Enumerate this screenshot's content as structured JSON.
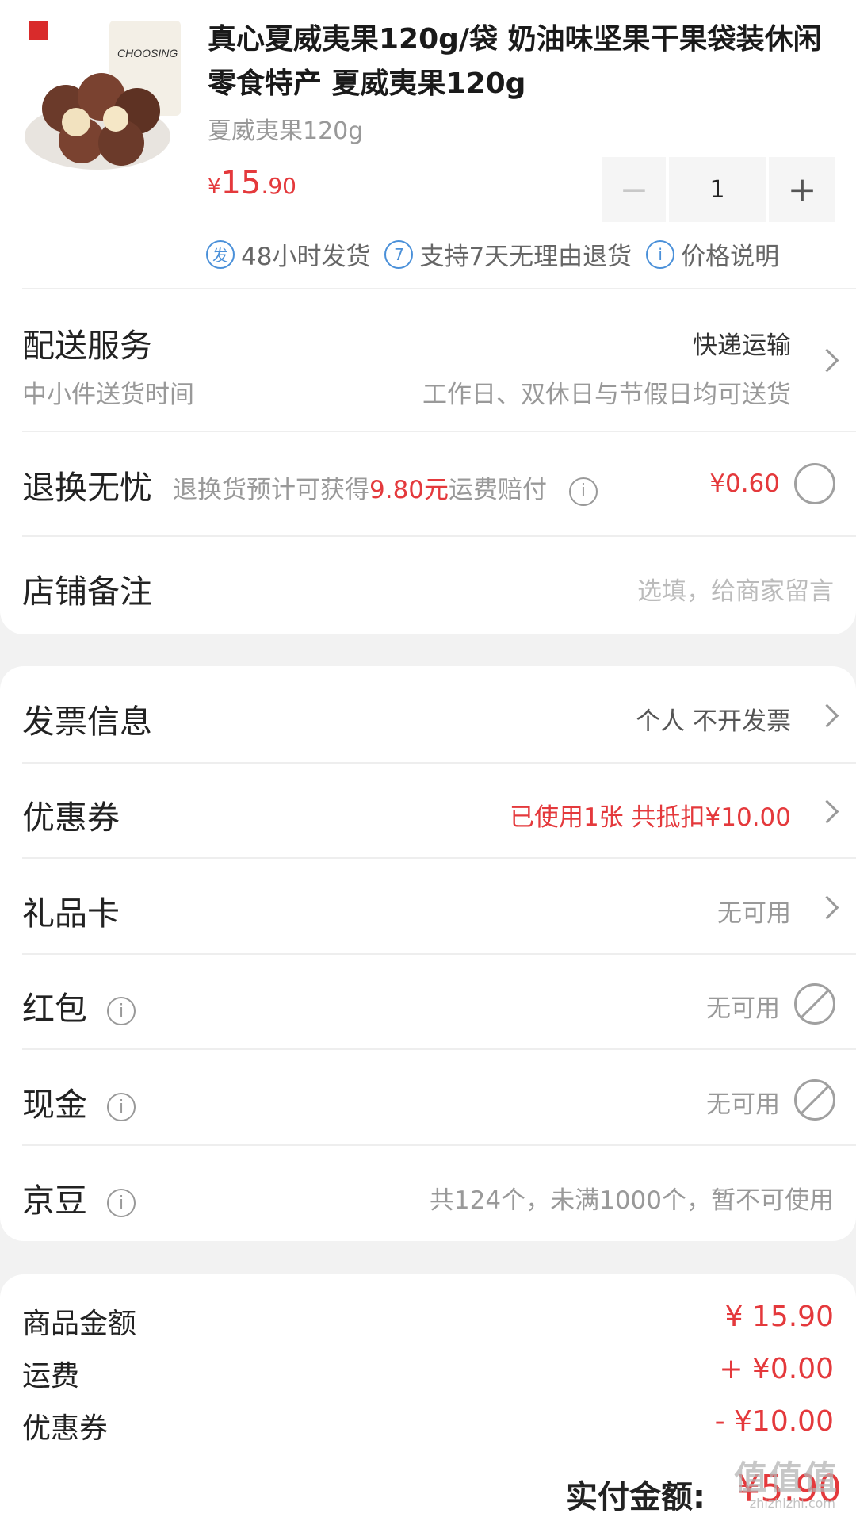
{
  "product": {
    "title": "真心夏威夷果120g/袋 奶油味坚果干果袋装休闲零食特产 夏威夷果120g",
    "spec": "夏威夷果120g",
    "price_currency": "¥",
    "price_int": "15",
    "price_dec": ".90",
    "quantity": "1",
    "badges": [
      {
        "icon_text": "发",
        "label": "48小时发货"
      },
      {
        "icon_text": "7",
        "label": "支持7天无理由退货"
      },
      {
        "icon_text": "i",
        "label": "价格说明"
      }
    ]
  },
  "delivery": {
    "title": "配送服务",
    "method": "快递运输",
    "sub_label": "中小件送货时间",
    "sub_value": "工作日、双休日与节假日均可送货"
  },
  "return_worry": {
    "title": "退换无忧",
    "desc_prefix": "退换货预计可获得",
    "desc_amount": "9.80元",
    "desc_suffix": "运费赔付",
    "price": "¥0.60"
  },
  "note": {
    "title": "店铺备注",
    "placeholder": "选填，给商家留言"
  },
  "invoice": {
    "title": "发票信息",
    "value": "个人 不开发票"
  },
  "coupon": {
    "title": "优惠券",
    "value": "已使用1张 共抵扣¥10.00"
  },
  "gift_card": {
    "title": "礼品卡",
    "value": "无可用"
  },
  "red_packet": {
    "title": "红包",
    "value": "无可用"
  },
  "cash": {
    "title": "现金",
    "value": "无可用"
  },
  "jd_beans": {
    "title": "京豆",
    "value": "共124个，未满1000个，暂不可使用"
  },
  "summary": {
    "items": [
      {
        "label": "商品金额",
        "value": "¥ 15.90"
      },
      {
        "label": "运费",
        "value": "+ ¥0.00"
      },
      {
        "label": "优惠券",
        "value": "- ¥10.00"
      }
    ],
    "total_label": "实付金额:",
    "total_value": "¥5.90"
  },
  "watermark": {
    "text": "值值值",
    "sub": "zhizhizhi.com"
  },
  "colors": {
    "accent_red": "#e4393c",
    "badge_blue": "#4a90d9"
  }
}
